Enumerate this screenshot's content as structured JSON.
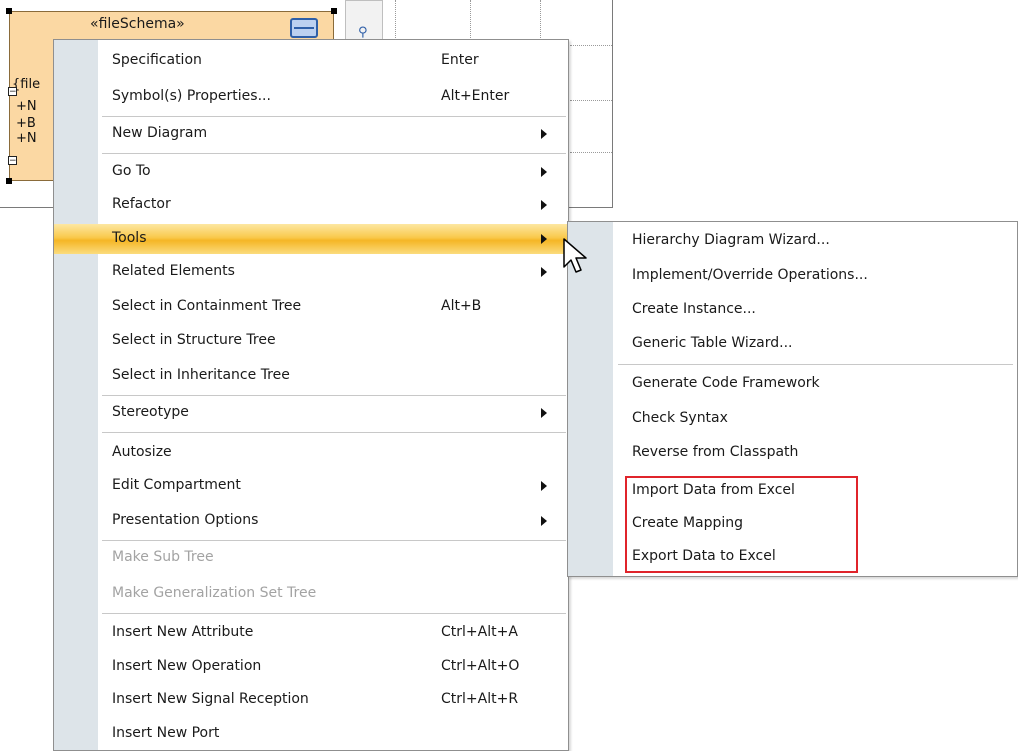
{
  "diagram": {
    "stereotype": "«fileSchema»",
    "side_text": [
      "{file",
      "+N",
      "+B",
      "+N"
    ]
  },
  "menu": {
    "items": [
      {
        "label": "Specification",
        "shortcut": "Enter"
      },
      {
        "label": "Symbol(s) Properties...",
        "shortcut": "Alt+Enter"
      },
      {
        "label": "New Diagram",
        "submenu": true
      },
      {
        "label": "Go To",
        "submenu": true
      },
      {
        "label": "Refactor",
        "submenu": true
      },
      {
        "label": "Tools",
        "submenu": true,
        "highlighted": true
      },
      {
        "label": "Related Elements",
        "submenu": true
      },
      {
        "label": "Select in Containment Tree",
        "shortcut": "Alt+B"
      },
      {
        "label": "Select in Structure Tree"
      },
      {
        "label": "Select in Inheritance Tree"
      },
      {
        "label": "Stereotype",
        "submenu": true
      },
      {
        "label": "Autosize"
      },
      {
        "label": "Edit Compartment",
        "submenu": true
      },
      {
        "label": "Presentation Options",
        "submenu": true
      },
      {
        "label": "Make Sub Tree",
        "disabled": true
      },
      {
        "label": "Make Generalization Set Tree",
        "disabled": true
      },
      {
        "label": "Insert New Attribute",
        "shortcut": "Ctrl+Alt+A"
      },
      {
        "label": "Insert New Operation",
        "shortcut": "Ctrl+Alt+O"
      },
      {
        "label": "Insert New Signal Reception",
        "shortcut": "Ctrl+Alt+R"
      },
      {
        "label": "Insert New Port"
      }
    ]
  },
  "tools_submenu": {
    "items": [
      {
        "label": "Hierarchy Diagram Wizard..."
      },
      {
        "label": "Implement/Override Operations..."
      },
      {
        "label": "Create Instance..."
      },
      {
        "label": "Generic Table Wizard..."
      },
      {
        "label": "Generate Code Framework"
      },
      {
        "label": "Check Syntax"
      },
      {
        "label": "Reverse from Classpath"
      },
      {
        "label": "Import Data from Excel"
      },
      {
        "label": "Create Mapping"
      },
      {
        "label": "Export Data to Excel"
      }
    ]
  },
  "colors": {
    "highlight_frame": "#e0242b",
    "menu_highlight": "#f5b625",
    "class_fill": "#fbd8a3"
  }
}
